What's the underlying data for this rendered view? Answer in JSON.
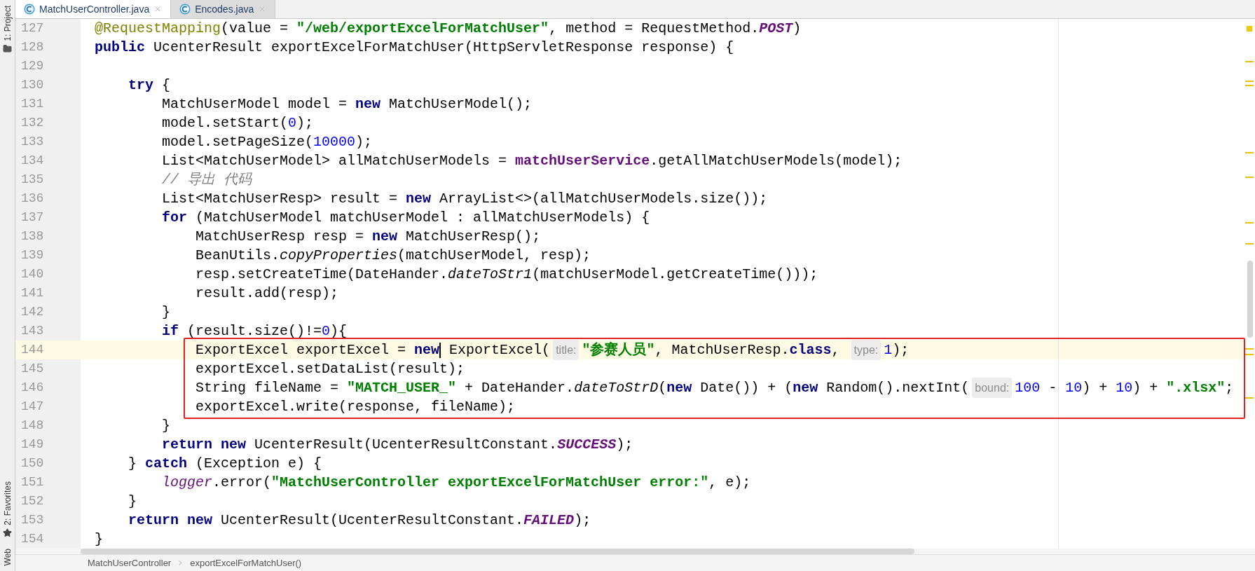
{
  "side_tools": [
    {
      "label": "1: Project",
      "kind": "folder"
    },
    {
      "label": "2: Favorites",
      "kind": "star"
    },
    {
      "label": "Web",
      "kind": "plain"
    }
  ],
  "tabs": [
    {
      "label": "MatchUserController.java",
      "selected": true
    },
    {
      "label": "Encodes.java",
      "selected": false
    }
  ],
  "lines": [
    {
      "number": "127",
      "highlighted": false,
      "boxed": false,
      "tokens": [
        {
          "kind": "annotation",
          "text": "@RequestMapping"
        },
        {
          "kind": "plain",
          "text": "(value = "
        },
        {
          "kind": "string",
          "text": "\"/web/exportExcelForMatchUser\""
        },
        {
          "kind": "plain",
          "text": ", method = RequestMethod."
        },
        {
          "kind": "constant",
          "text": "POST"
        },
        {
          "kind": "plain",
          "text": ")"
        }
      ]
    },
    {
      "number": "128",
      "highlighted": false,
      "boxed": false,
      "tokens": [
        {
          "kind": "keyword",
          "text": "public"
        },
        {
          "kind": "plain",
          "text": " UcenterResult exportExcelForMatchUser(HttpServletResponse response) {"
        }
      ]
    },
    {
      "number": "129",
      "highlighted": false,
      "boxed": false
    },
    {
      "number": "130",
      "highlighted": false,
      "boxed": false,
      "tokens": [
        {
          "kind": "keyword",
          "text": "    try"
        },
        {
          "kind": "plain",
          "text": " {"
        }
      ]
    },
    {
      "number": "131",
      "highlighted": false,
      "boxed": false,
      "tokens": [
        {
          "kind": "plain",
          "text": "        MatchUserModel model = "
        },
        {
          "kind": "keyword",
          "text": "new"
        },
        {
          "kind": "plain",
          "text": " MatchUserModel();"
        }
      ]
    },
    {
      "number": "132",
      "highlighted": false,
      "boxed": false,
      "tokens": [
        {
          "kind": "plain",
          "text": "        model.setStart("
        },
        {
          "kind": "number",
          "text": "0"
        },
        {
          "kind": "plain",
          "text": ");"
        }
      ]
    },
    {
      "number": "133",
      "highlighted": false,
      "boxed": false,
      "tokens": [
        {
          "kind": "plain",
          "text": "        model.setPageSize("
        },
        {
          "kind": "number",
          "text": "10000"
        },
        {
          "kind": "plain",
          "text": ");"
        }
      ]
    },
    {
      "number": "134",
      "highlighted": false,
      "boxed": false,
      "tokens": [
        {
          "kind": "plain",
          "text": "        List<MatchUserModel> allMatchUserModels = "
        },
        {
          "kind": "field",
          "text": "matchUserService"
        },
        {
          "kind": "plain",
          "text": ".getAllMatchUserModels(model);"
        }
      ]
    },
    {
      "number": "135",
      "highlighted": false,
      "boxed": false,
      "tokens": [
        {
          "kind": "comment",
          "text": "        // 导出 代码"
        }
      ]
    },
    {
      "number": "136",
      "highlighted": false,
      "boxed": false,
      "tokens": [
        {
          "kind": "plain",
          "text": "        List<MatchUserResp> result = "
        },
        {
          "kind": "keyword",
          "text": "new"
        },
        {
          "kind": "plain",
          "text": " ArrayList<>(allMatchUserModels.size());"
        }
      ]
    },
    {
      "number": "137",
      "highlighted": false,
      "boxed": false,
      "tokens": [
        {
          "kind": "keyword",
          "text": "        for"
        },
        {
          "kind": "plain",
          "text": " (MatchUserModel matchUserModel : allMatchUserModels) {"
        }
      ]
    },
    {
      "number": "138",
      "highlighted": false,
      "boxed": false,
      "tokens": [
        {
          "kind": "plain",
          "text": "            MatchUserResp resp = "
        },
        {
          "kind": "keyword",
          "text": "new"
        },
        {
          "kind": "plain",
          "text": " MatchUserResp();"
        }
      ]
    },
    {
      "number": "139",
      "highlighted": false,
      "boxed": false,
      "tokens": [
        {
          "kind": "plain",
          "text": "            BeanUtils."
        },
        {
          "kind": "static_call",
          "text": "copyProperties"
        },
        {
          "kind": "plain",
          "text": "(matchUserModel, resp);"
        }
      ]
    },
    {
      "number": "140",
      "highlighted": false,
      "boxed": false,
      "tokens": [
        {
          "kind": "plain",
          "text": "            resp.setCreateTime(DateHander."
        },
        {
          "kind": "static_call",
          "text": "dateToStr1"
        },
        {
          "kind": "plain",
          "text": "(matchUserModel.getCreateTime()));"
        }
      ]
    },
    {
      "number": "141",
      "highlighted": false,
      "boxed": false,
      "tokens": [
        {
          "kind": "plain",
          "text": "            result.add(resp);"
        }
      ]
    },
    {
      "number": "142",
      "highlighted": false,
      "boxed": false,
      "tokens": [
        {
          "kind": "plain",
          "text": "        }"
        }
      ]
    },
    {
      "number": "143",
      "highlighted": false,
      "boxed": false,
      "tokens": [
        {
          "kind": "keyword",
          "text": "        if"
        },
        {
          "kind": "plain",
          "text": " (result.size()!="
        },
        {
          "kind": "number",
          "text": "0"
        },
        {
          "kind": "plain",
          "text": "){"
        }
      ]
    },
    {
      "number": "144",
      "highlighted": true,
      "boxed": true,
      "tokens": [
        {
          "kind": "plain",
          "text": "            ExportExcel exportExcel = "
        },
        {
          "kind": "keyword",
          "text": "new",
          "caret": true
        },
        {
          "kind": "plain",
          "text": " ExportExcel("
        },
        {
          "kind": "hint",
          "text": "title:"
        },
        {
          "kind": "string",
          "text": "\"参赛人员\""
        },
        {
          "kind": "plain",
          "text": ", MatchUserResp."
        },
        {
          "kind": "keyword",
          "text": "class"
        },
        {
          "kind": "plain",
          "text": ", "
        },
        {
          "kind": "hint",
          "text": "type:"
        },
        {
          "kind": "number",
          "text": "1"
        },
        {
          "kind": "plain",
          "text": ");"
        }
      ]
    },
    {
      "number": "145",
      "highlighted": false,
      "boxed": true,
      "tokens": [
        {
          "kind": "plain",
          "text": "            exportExcel.setDataList(result);"
        }
      ]
    },
    {
      "number": "146",
      "highlighted": false,
      "boxed": true,
      "tokens": [
        {
          "kind": "plain",
          "text": "            String fileName = "
        },
        {
          "kind": "string",
          "text": "\"MATCH_USER_\""
        },
        {
          "kind": "plain",
          "text": " + DateHander."
        },
        {
          "kind": "static_call",
          "text": "dateToStrD"
        },
        {
          "kind": "plain",
          "text": "("
        },
        {
          "kind": "keyword",
          "text": "new"
        },
        {
          "kind": "plain",
          "text": " Date()) + ("
        },
        {
          "kind": "keyword",
          "text": "new"
        },
        {
          "kind": "plain",
          "text": " Random().nextInt("
        },
        {
          "kind": "hint",
          "text": "bound:"
        },
        {
          "kind": "number",
          "text": "100"
        },
        {
          "kind": "plain",
          "text": " - "
        },
        {
          "kind": "number",
          "text": "10"
        },
        {
          "kind": "plain",
          "text": ") + "
        },
        {
          "kind": "number",
          "text": "10"
        },
        {
          "kind": "plain",
          "text": ") + "
        },
        {
          "kind": "string",
          "text": "\".xlsx\""
        },
        {
          "kind": "plain",
          "text": ";"
        }
      ]
    },
    {
      "number": "147",
      "highlighted": false,
      "boxed": true,
      "tokens": [
        {
          "kind": "plain",
          "text": "            exportExcel.write(response, fileName);"
        }
      ]
    },
    {
      "number": "148",
      "highlighted": false,
      "boxed": false,
      "tokens": [
        {
          "kind": "plain",
          "text": "        }"
        }
      ]
    },
    {
      "number": "149",
      "highlighted": false,
      "boxed": false,
      "tokens": [
        {
          "kind": "keyword",
          "text": "        return new"
        },
        {
          "kind": "plain",
          "text": " UcenterResult(UcenterResultConstant."
        },
        {
          "kind": "constant",
          "text": "SUCCESS"
        },
        {
          "kind": "plain",
          "text": ");"
        }
      ]
    },
    {
      "number": "150",
      "highlighted": false,
      "boxed": false,
      "tokens": [
        {
          "kind": "plain",
          "text": "    } "
        },
        {
          "kind": "keyword",
          "text": "catch"
        },
        {
          "kind": "plain",
          "text": " (Exception e) {"
        }
      ]
    },
    {
      "number": "151",
      "highlighted": false,
      "boxed": false,
      "tokens": [
        {
          "kind": "static_field",
          "text": "        logger"
        },
        {
          "kind": "plain",
          "text": ".error("
        },
        {
          "kind": "string",
          "text": "\"MatchUserController exportExcelForMatchUser error:\""
        },
        {
          "kind": "plain",
          "text": ", e);"
        }
      ]
    },
    {
      "number": "152",
      "highlighted": false,
      "boxed": false,
      "tokens": [
        {
          "kind": "plain",
          "text": "    }"
        }
      ]
    },
    {
      "number": "153",
      "highlighted": false,
      "boxed": false,
      "tokens": [
        {
          "kind": "keyword",
          "text": "    return new"
        },
        {
          "kind": "plain",
          "text": " UcenterResult(UcenterResultConstant."
        },
        {
          "kind": "constant",
          "text": "FAILED"
        },
        {
          "kind": "plain",
          "text": ");"
        }
      ]
    },
    {
      "number": "154",
      "highlighted": false,
      "boxed": false,
      "tokens": [
        {
          "kind": "plain",
          "text": "}"
        }
      ]
    }
  ],
  "breadcrumb": [
    "MatchUserController",
    "exportExcelForMatchUser()"
  ]
}
